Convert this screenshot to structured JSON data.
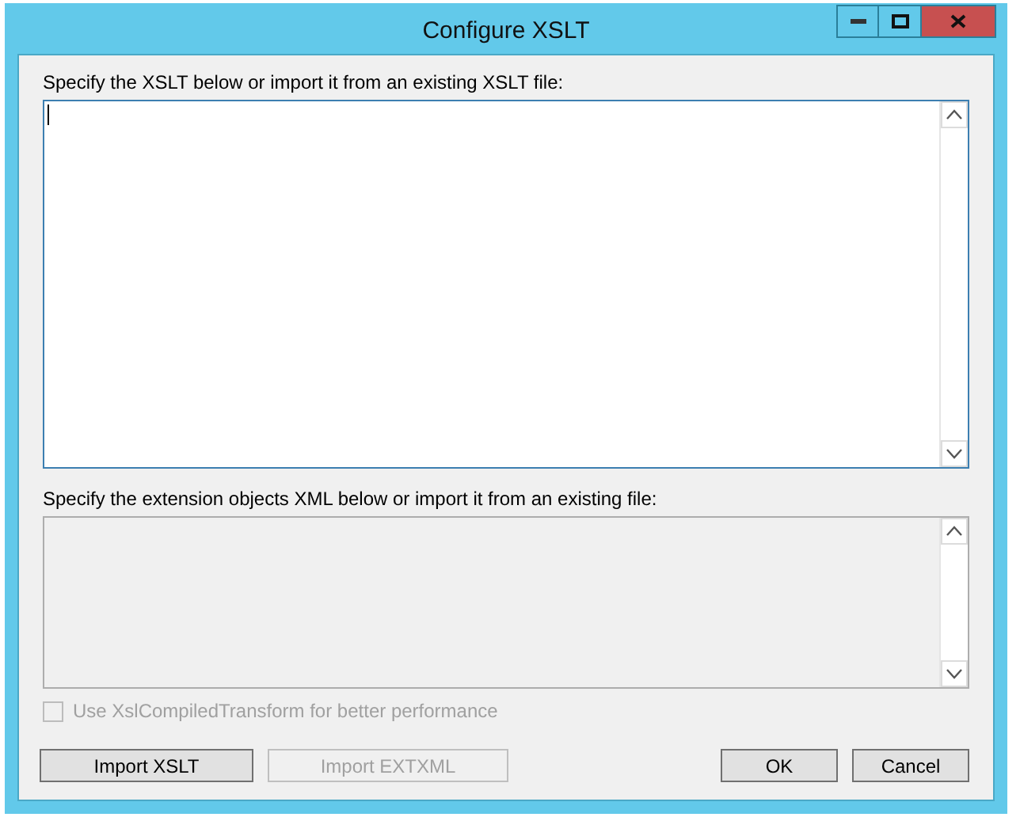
{
  "window": {
    "title": "Configure XSLT"
  },
  "xslt_editor": {
    "label": "Specify the XSLT below or import it from an existing XSLT file:",
    "disabled": false,
    "focused": true
  },
  "extension_editor": {
    "label": "Specify the extension objects XML below or import it from an existing file:",
    "disabled": true,
    "focused": false
  },
  "compiled_option": {
    "label": "Use XslCompiledTransform for better performance",
    "checked": false,
    "disabled": true
  },
  "left_buttons": [
    {
      "label": "Import XSLT",
      "disabled": false
    },
    {
      "label": "Import EXTXML",
      "disabled": true
    }
  ],
  "right_buttons": [
    {
      "label": "OK",
      "disabled": false
    },
    {
      "label": "Cancel",
      "disabled": false
    }
  ]
}
